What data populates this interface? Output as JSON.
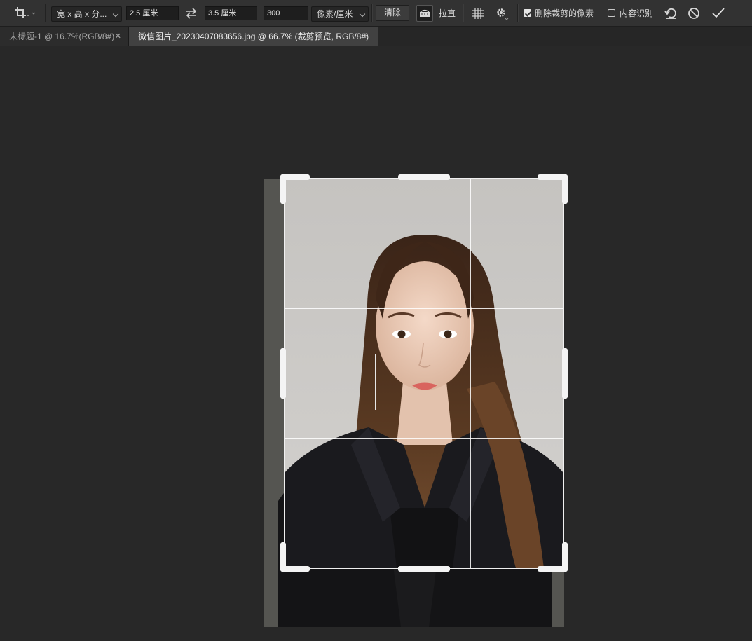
{
  "options_bar": {
    "tool": "crop-tool",
    "ratio_preset": "宽 x 高 x 分...",
    "width_value": "2.5 厘米",
    "height_value": "3.5 厘米",
    "resolution_value": "300",
    "resolution_unit": "像素/厘米",
    "clear_label": "清除",
    "straighten_label": "拉直",
    "delete_cropped_label": "删除裁剪的像素",
    "delete_cropped_checked": true,
    "content_aware_label": "内容识别",
    "content_aware_checked": false
  },
  "tabs": [
    {
      "label": "未标题-1 @ 16.7%(RGB/8#)",
      "active": false
    },
    {
      "label": "微信图片_20230407083656.jpg @ 66.7% (裁剪预览, RGB/8#)",
      "active": true
    }
  ],
  "colors": {
    "panel": "#323232",
    "workspace": "#282828",
    "crop_handle": "#f4f4f4"
  }
}
